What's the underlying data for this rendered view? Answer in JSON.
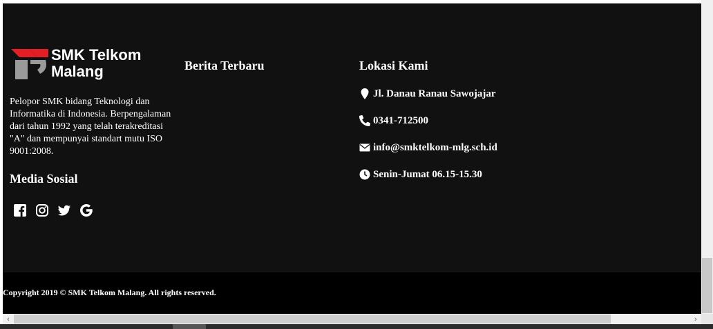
{
  "brand": {
    "logo_line1": "SMK Telkom",
    "logo_line2": "Malang",
    "accent": "#e31e24",
    "mark_gray": "#9a9a9a"
  },
  "about": {
    "description": "Pelopor SMK bidang Teknologi dan Informatika di Indonesia. Berpengalaman dari tahun 1992 yang telah terakreditasi \"A\" dan mempunyai standart mutu ISO 9001:2008."
  },
  "media": {
    "title": "Media Sosial",
    "icons": [
      "facebook-icon",
      "instagram-icon",
      "twitter-icon",
      "google-icon"
    ]
  },
  "news": {
    "title": "Berita Terbaru"
  },
  "location": {
    "title": "Lokasi Kami",
    "address": "Jl. Danau Ranau Sawojajar",
    "phone": "0341-712500",
    "email": "info@smktelkom-mlg.sch.id",
    "hours": "Senin-Jumat 06.15-15.30"
  },
  "footer": {
    "copyright": "Copyright 2019 © SMK Telkom Malang. All rights reserved."
  },
  "colors": {
    "footer_bg": "#111111",
    "bottom_bg": "#000000",
    "text": "#ffffff"
  }
}
